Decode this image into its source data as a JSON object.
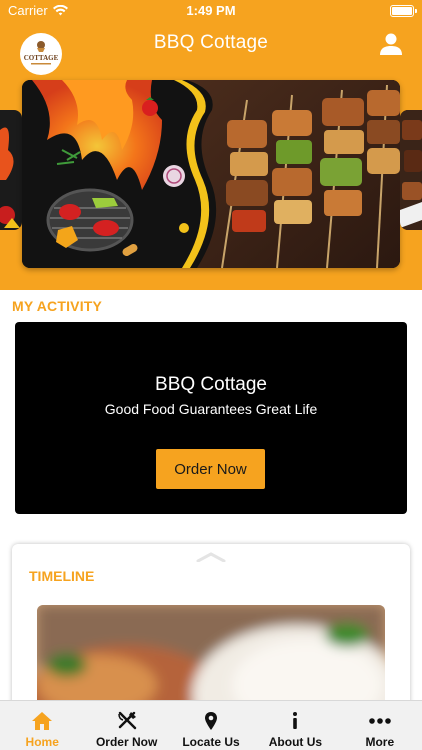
{
  "status_bar": {
    "carrier": "Carrier",
    "time": "1:49 PM"
  },
  "header": {
    "title": "BBQ Cottage",
    "logo_text": "COTTAGE"
  },
  "sections": {
    "activity_title": "MY ACTIVITY",
    "timeline_title": "TIMELINE"
  },
  "promo": {
    "title": "BBQ Cottage",
    "subtitle": "Good Food Guarantees Great Life",
    "button_label": "Order Now"
  },
  "tabs": [
    {
      "label": "Home",
      "icon": "home-icon",
      "active": true
    },
    {
      "label": "Order Now",
      "icon": "fork-knife-icon",
      "active": false
    },
    {
      "label": "Locate Us",
      "icon": "location-pin-icon",
      "active": false
    },
    {
      "label": "About Us",
      "icon": "info-icon",
      "active": false
    },
    {
      "label": "More",
      "icon": "more-dots-icon",
      "active": false
    }
  ],
  "colors": {
    "brand": "#f6a31f",
    "promo_background": "#000000",
    "tabbar_background": "#f1f1f1"
  }
}
